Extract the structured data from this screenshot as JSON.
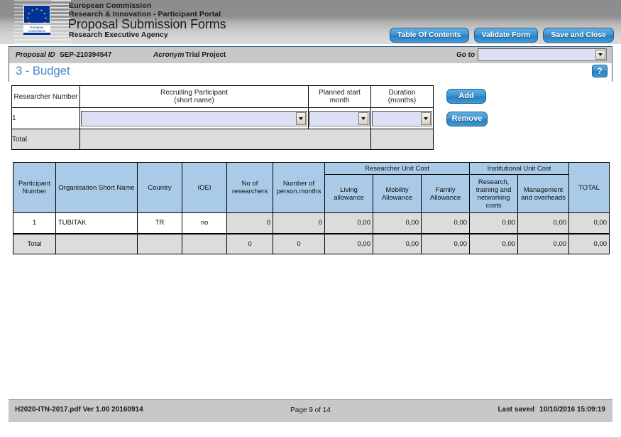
{
  "header": {
    "org_line1": "European Commission",
    "org_line2": "Research & Innovation - Participant Portal",
    "app_title": "Proposal Submission Forms",
    "agency": "Research Executive Agency",
    "logo_caption_line1": "European",
    "logo_caption_line2": "Commission",
    "buttons": [
      {
        "id": "table-of-contents",
        "label": "Table Of Contents"
      },
      {
        "id": "validate-form",
        "label": "Validate Form"
      },
      {
        "id": "save-and-close",
        "label": "Save and Close"
      }
    ]
  },
  "infobar": {
    "proposal_id_label": "Proposal ID",
    "proposal_id_value": "SEP-210394547",
    "acronym_label": "Acronym",
    "acronym_value": "Trial Project",
    "goto_label": "Go to",
    "goto_value": "",
    "goto_placeholder": ""
  },
  "page": {
    "title": "3 - Budget",
    "help_label": "?"
  },
  "researcher_table": {
    "headers": {
      "researcher_number": "Researcher Number",
      "recruiting_participant_l1": "Recruiting Participant",
      "recruiting_participant_l2": "(short name)",
      "planned_start_month": "Planned start month",
      "duration_l1": "Duration",
      "duration_l2": "(months)"
    },
    "rows": [
      {
        "researcher_number": "1",
        "recruiting_participant": "",
        "planned_start_month": "",
        "duration": ""
      }
    ],
    "total_label": "Total",
    "total_duration": ""
  },
  "actions": {
    "add_label": "Add",
    "remove_label": "Remove"
  },
  "budget_table": {
    "group_headers": {
      "researcher_unit_cost": "Researcher Unit Cost",
      "institutional_unit_cost": "Institutional Unit Cost"
    },
    "columns": [
      {
        "id": "participant-number",
        "l1": "Participant",
        "l2": "Number"
      },
      {
        "id": "organisation-short-name",
        "l1": "Organisation Short Name",
        "l2": ""
      },
      {
        "id": "country",
        "l1": "Country",
        "l2": ""
      },
      {
        "id": "ioei",
        "l1": "IOEI",
        "l2": ""
      },
      {
        "id": "no-of-researchers",
        "l1": "No of",
        "l2": "researchers"
      },
      {
        "id": "number-of-person-months",
        "l1": "Number of",
        "l2": "person.months"
      },
      {
        "id": "living-allowance",
        "l1": "Living",
        "l2": "allowance"
      },
      {
        "id": "mobility-allowance",
        "l1": "Mobility",
        "l2": "Allowance"
      },
      {
        "id": "family-allowance",
        "l1": "Family",
        "l2": "Allowance"
      },
      {
        "id": "research-training-networking-costs",
        "l1": "Research,",
        "l2": "training and",
        "l3": "networking",
        "l4": "costs"
      },
      {
        "id": "management-and-overheads",
        "l1": "Management",
        "l2": "and overheads"
      },
      {
        "id": "total",
        "l1": "TOTAL",
        "l2": ""
      }
    ],
    "rows": [
      {
        "participant_number": "1",
        "organisation_short_name": "TUBITAK",
        "country": "TR",
        "ioei": "no",
        "no_of_researchers": "0",
        "number_of_person_months": "0",
        "living_allowance": "0,00",
        "mobility_allowance": "0,00",
        "family_allowance": "0,00",
        "research_training_networking_costs": "0,00",
        "management_and_overheads": "0,00",
        "total": "0,00"
      }
    ],
    "total_row": {
      "label": "Total",
      "organisation_short_name": "",
      "country": "",
      "ioei": "",
      "no_of_researchers": "0",
      "number_of_person_months": "0",
      "living_allowance": "0,00",
      "mobility_allowance": "0,00",
      "family_allowance": "0,00",
      "research_training_networking_costs": "0,00",
      "management_and_overheads": "0,00",
      "total": "0,00"
    }
  },
  "footer": {
    "document": "H2020-ITN-2017.pdf Ver 1.00 20160914",
    "page": "Page 9 of 14",
    "last_saved_label": "Last saved",
    "last_saved_value": "10/10/2016 15:09:19"
  },
  "colors": {
    "accent_blue": "#3f93d0",
    "table_header_blue": "#a9cbe7",
    "grey_cell": "#dcdcdc",
    "bar_grey": "#c8c8c8",
    "title_blue": "#4a87c4",
    "field_blue": "#dce0f5"
  }
}
